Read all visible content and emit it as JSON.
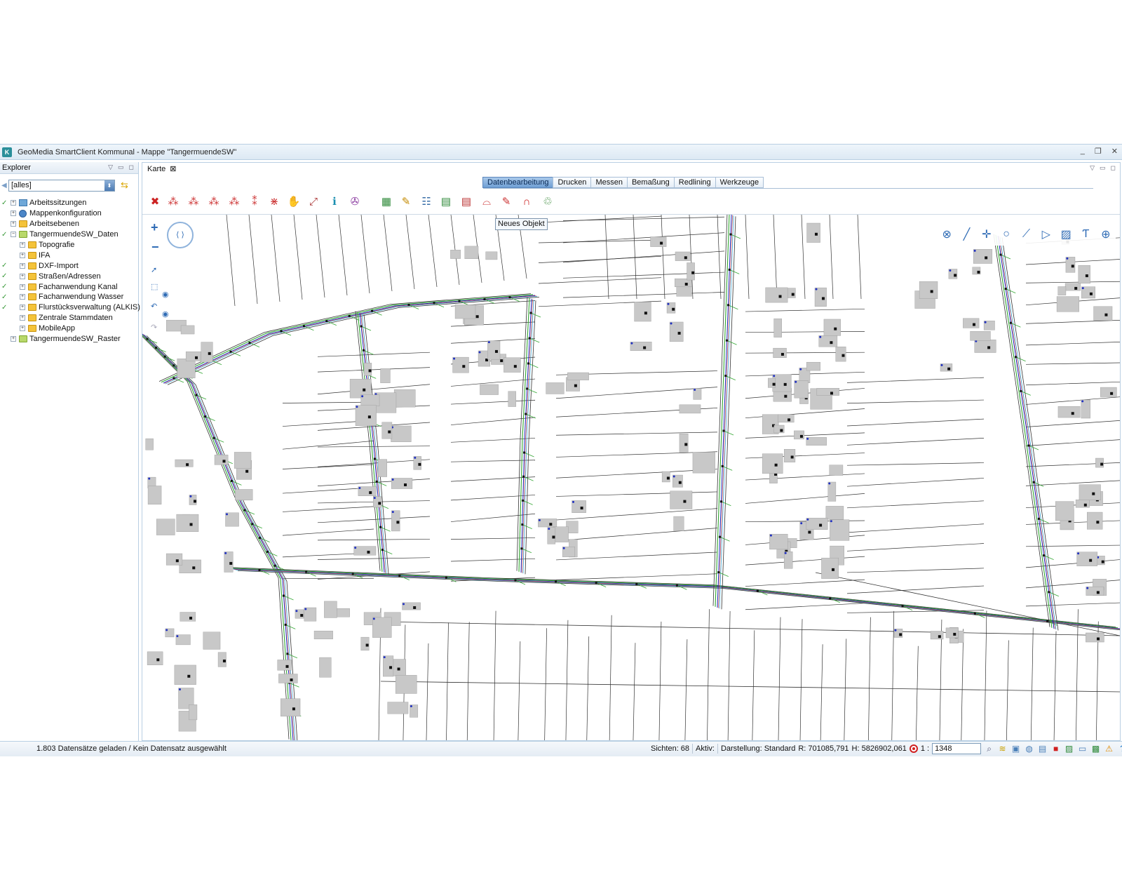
{
  "window": {
    "title": "GeoMedia SmartClient Kommunal - Mappe \"TangermuendeSW\"",
    "controls": {
      "minimize": "_",
      "restore": "❐",
      "close": "✕"
    }
  },
  "explorer": {
    "title": "Explorer",
    "filter_value": "[alles]",
    "tree": [
      {
        "label": "Arbeitssitzungen",
        "checked": true,
        "level": 0,
        "icon": "session-icon"
      },
      {
        "label": "Mappenkonfiguration",
        "checked": false,
        "level": 0,
        "icon": "globe-icon"
      },
      {
        "label": "Arbeitsebenen",
        "checked": false,
        "level": 0,
        "icon": "folder-icon"
      },
      {
        "label": "TangermuendeSW_Daten",
        "checked": true,
        "level": 0,
        "icon": "folder-open-icon",
        "expanded": true
      },
      {
        "label": "Topografie",
        "checked": false,
        "level": 1,
        "icon": "folder-icon"
      },
      {
        "label": "IFA",
        "checked": false,
        "level": 1,
        "icon": "folder-icon"
      },
      {
        "label": "DXF-Import",
        "checked": true,
        "level": 1,
        "icon": "folder-icon"
      },
      {
        "label": "Straßen/Adressen",
        "checked": true,
        "level": 1,
        "icon": "folder-icon"
      },
      {
        "label": "Fachanwendung Kanal",
        "checked": true,
        "level": 1,
        "icon": "folder-icon"
      },
      {
        "label": "Fachanwendung Wasser",
        "checked": true,
        "level": 1,
        "icon": "folder-icon"
      },
      {
        "label": "Flurstücksverwaltung (ALKIS)",
        "checked": true,
        "level": 1,
        "icon": "folder-icon"
      },
      {
        "label": "Zentrale Stammdaten",
        "checked": false,
        "level": 1,
        "icon": "folder-icon"
      },
      {
        "label": "MobileApp",
        "checked": false,
        "level": 1,
        "icon": "folder-icon"
      },
      {
        "label": "TangermuendeSW_Raster",
        "checked": false,
        "level": 0,
        "icon": "folder-open-icon"
      }
    ]
  },
  "map": {
    "tab_label": "Karte",
    "ribbon_tabs": [
      "Datenbearbeitung",
      "Drucken",
      "Messen",
      "Bemaßung",
      "Redlining",
      "Werkzeuge"
    ],
    "active_tab": "Datenbearbeitung",
    "tooltip": "Neues Objekt",
    "toolbar_icons": [
      "delete-icon",
      "select-multi-icon",
      "select-add-icon",
      "select-remove-icon",
      "select-area-icon",
      "select-line-icon",
      "select-polygon-icon",
      "pan-hand-icon",
      "zoom-extent-icon",
      "info-icon",
      "navigation-wheel-icon",
      "new-object-icon",
      "edit-object-icon",
      "attribute-table-icon",
      "layer-edit-icon",
      "layer-delete-icon",
      "shape-edit-icon",
      "note-edit-icon",
      "undo-arc-icon",
      "trash-icon"
    ],
    "draw_tools": [
      "cancel-drawing-icon",
      "line-tool-icon",
      "point-tool-icon",
      "circle-tool-icon",
      "polyline-tool-icon",
      "polygon-tool-icon",
      "hatch-tool-icon",
      "text-tool-icon",
      "snap-tool-icon"
    ]
  },
  "status": {
    "message": "1.803 Datensätze geladen / Kein Datensatz ausgewählt",
    "views": "Sichten: 68",
    "active": "Aktiv:",
    "display": "Darstellung: Standard",
    "r_coord": "R: 701085,791",
    "h_coord": "H: 5826902,061",
    "scale_prefix": "1 :",
    "scale_value": "1348"
  },
  "colors": {
    "accent": "#6f9fd4",
    "titlebar": "#dde9f4",
    "building": "#c8c8c8",
    "pipe_green": "#33a633",
    "pipe_blue": "#2030c0",
    "pipe_red": "#d03030",
    "pipe_cyan": "#39a8d8"
  }
}
